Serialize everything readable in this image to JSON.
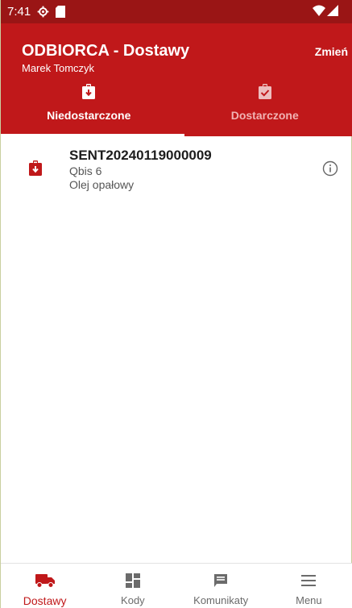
{
  "status_bar": {
    "time": "7:41",
    "icons": [
      "settings-gear-icon",
      "sd-card-icon",
      "wifi-icon",
      "signal-icon"
    ]
  },
  "app_bar": {
    "title": "ODBIORCA - Dostawy",
    "subtitle": "Marek Tomczyk",
    "change_label": "Zmień"
  },
  "tabs": [
    {
      "label": "Niedostarczone",
      "icon": "clipboard-arrow-down-icon",
      "active": true
    },
    {
      "label": "Dostarczone",
      "icon": "clipboard-check-icon",
      "active": false
    }
  ],
  "list": [
    {
      "icon": "clipboard-arrow-down-icon",
      "title": "SENT20240119000009",
      "line1": "Qbis 6",
      "line2": "Olej opałowy",
      "action_icon": "info-icon"
    }
  ],
  "bottom_nav": [
    {
      "label": "Dostawy",
      "icon": "truck-icon",
      "active": true
    },
    {
      "label": "Kody",
      "icon": "dashboard-grid-icon",
      "active": false
    },
    {
      "label": "Komunikaty",
      "icon": "message-icon",
      "active": false
    },
    {
      "label": "Menu",
      "icon": "hamburger-menu-icon",
      "active": false
    }
  ],
  "colors": {
    "status_bar": "#9a1515",
    "app_bar": "#c0181a",
    "accent": "#c0181a",
    "inactive_nav": "#6b6b6b"
  }
}
